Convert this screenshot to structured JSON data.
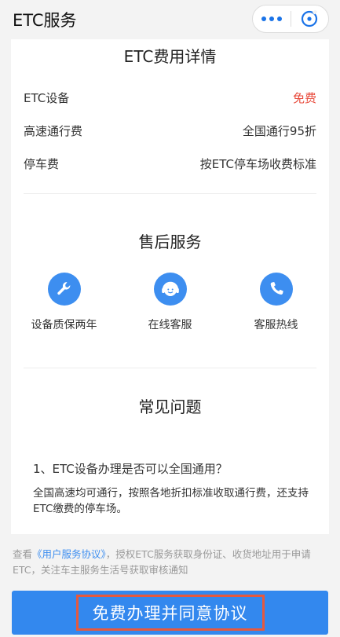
{
  "header": {
    "title": "ETC服务",
    "more_icon": "more-dots-icon",
    "close_icon": "close-circle-icon"
  },
  "fees": {
    "title": "ETC费用详情",
    "rows": [
      {
        "label": "ETC设备",
        "value": "免费"
      },
      {
        "label": "高速通行费",
        "value": "全国通行95折"
      },
      {
        "label": "停车费",
        "value": "按ETC停车场收费标准"
      }
    ]
  },
  "after_sales": {
    "title": "售后服务",
    "items": [
      {
        "label": "设备质保两年",
        "icon": "wrench-icon"
      },
      {
        "label": "在线客服",
        "icon": "customer-service-icon"
      },
      {
        "label": "客服热线",
        "icon": "phone-icon"
      }
    ]
  },
  "faq": {
    "title": "常见问题",
    "question": "1、ETC设备办理是否可以全国通用？",
    "answer": "全国高速均可通行，按照各地折扣标准收取通行费，还支持ETC缴费的停车场。"
  },
  "agreement": {
    "prefix": "查看",
    "link": "《用户服务协议》",
    "suffix": "，授权ETC服务获取身份证、收货地址用于申请ETC，关注车主服务生活号获取审核通知"
  },
  "cta": {
    "label": "免费办理并同意协议"
  },
  "colors": {
    "accent": "#3388ee",
    "free": "#e84b3c",
    "highlight_border": "#e5593e"
  }
}
